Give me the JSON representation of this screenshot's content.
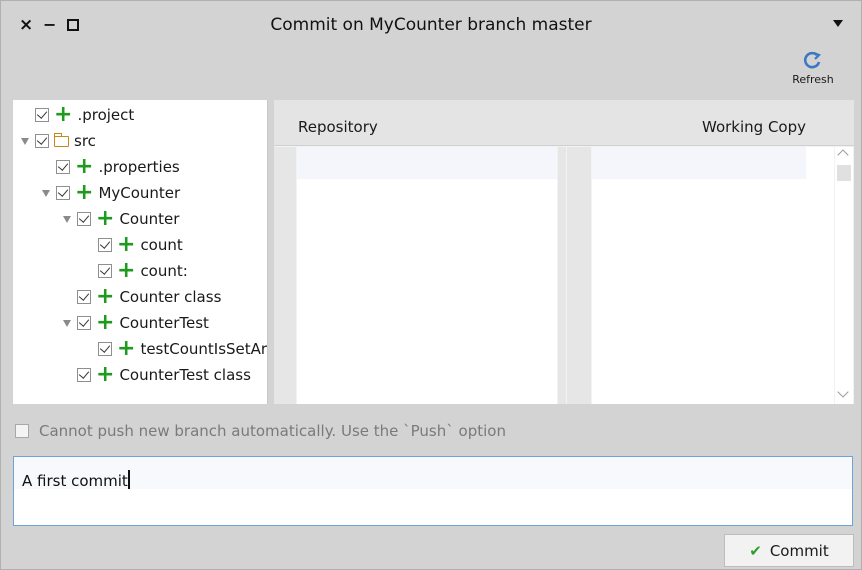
{
  "window": {
    "title": "Commit on MyCounter branch master",
    "controls": {
      "close": "×",
      "minimize": "−"
    }
  },
  "toolbar": {
    "refresh_label": "Refresh",
    "refresh_icon": "refresh-icon"
  },
  "tree": {
    "items": [
      {
        "label": ".project",
        "depth": 0,
        "expandable": false,
        "icon": "plus-icon",
        "checked": true
      },
      {
        "label": "src",
        "depth": 0,
        "expandable": true,
        "icon": "folder-icon",
        "checked": true
      },
      {
        "label": ".properties",
        "depth": 1,
        "expandable": false,
        "icon": "plus-icon",
        "checked": true
      },
      {
        "label": "MyCounter",
        "depth": 1,
        "expandable": true,
        "icon": "plus-icon",
        "checked": true
      },
      {
        "label": "Counter",
        "depth": 2,
        "expandable": true,
        "icon": "plus-icon",
        "checked": true
      },
      {
        "label": "count",
        "depth": 3,
        "expandable": false,
        "icon": "plus-icon",
        "checked": true
      },
      {
        "label": "count:",
        "depth": 3,
        "expandable": false,
        "icon": "plus-icon",
        "checked": true
      },
      {
        "label": "Counter class",
        "depth": 2,
        "expandable": false,
        "icon": "plus-icon",
        "checked": true
      },
      {
        "label": "CounterTest",
        "depth": 2,
        "expandable": true,
        "icon": "plus-icon",
        "checked": true
      },
      {
        "label": "testCountIsSetAr",
        "depth": 3,
        "expandable": false,
        "icon": "plus-icon",
        "checked": true
      },
      {
        "label": "CounterTest class",
        "depth": 2,
        "expandable": false,
        "icon": "plus-icon",
        "checked": true
      }
    ]
  },
  "diff": {
    "repository_label": "Repository",
    "working_copy_label": "Working Copy"
  },
  "push_option": {
    "label": "Cannot push new branch automatically. Use the `Push` option",
    "checked": false
  },
  "message": {
    "value": "A first commit"
  },
  "commit_button": {
    "label": "Commit"
  },
  "colors": {
    "plus": "#1f9a1f",
    "folder": "#c88a15",
    "focus_border": "#6fa3d8",
    "commit_check": "#2e9e2e"
  }
}
